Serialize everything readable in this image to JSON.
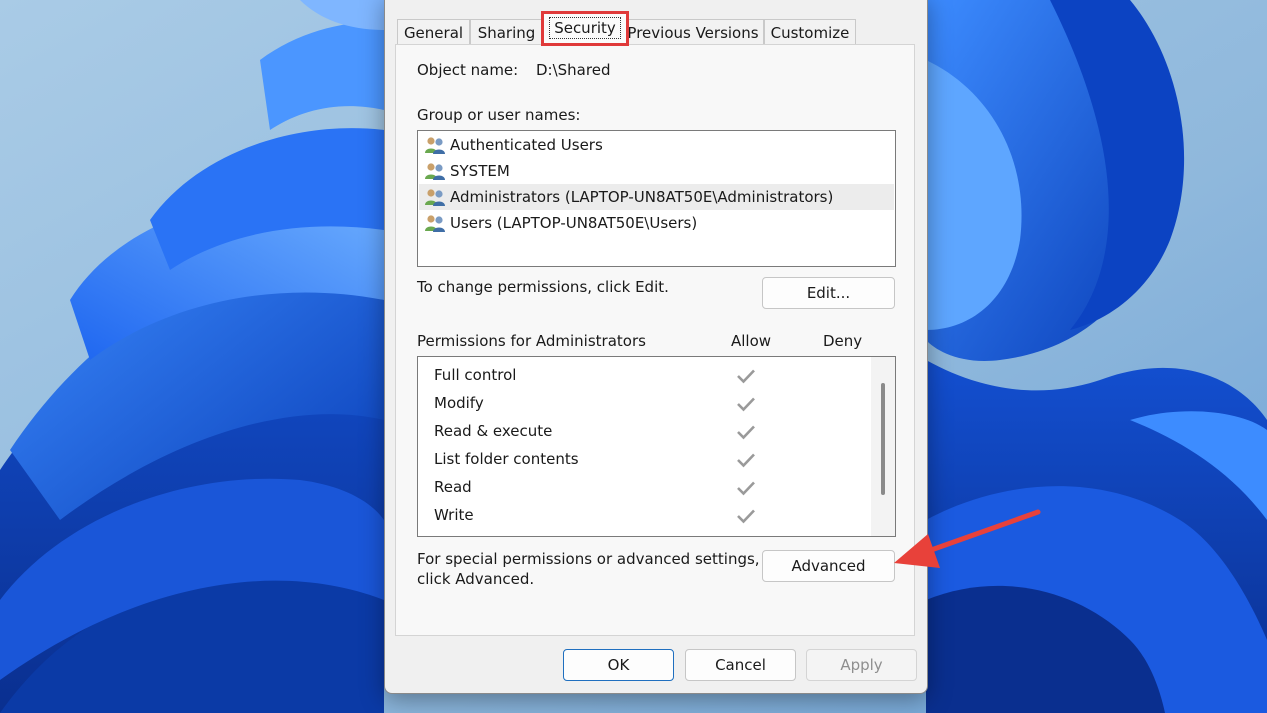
{
  "tabs": [
    {
      "label": "General"
    },
    {
      "label": "Sharing"
    },
    {
      "label": "Security"
    },
    {
      "label": "Previous Versions"
    },
    {
      "label": "Customize"
    }
  ],
  "object": {
    "label": "Object name:",
    "value": "D:\\Shared"
  },
  "groups": {
    "label": "Group or user names:",
    "items": [
      {
        "label": "Authenticated Users"
      },
      {
        "label": "SYSTEM"
      },
      {
        "label": "Administrators (LAPTOP-UN8AT50E\\Administrators)"
      },
      {
        "label": "Users (LAPTOP-UN8AT50E\\Users)"
      }
    ]
  },
  "edit": {
    "text": "To change permissions, click Edit.",
    "button": "Edit..."
  },
  "permissions": {
    "label": "Permissions for Administrators",
    "allow_header": "Allow",
    "deny_header": "Deny",
    "items": [
      {
        "name": "Full control",
        "allow": true,
        "deny": false
      },
      {
        "name": "Modify",
        "allow": true,
        "deny": false
      },
      {
        "name": "Read & execute",
        "allow": true,
        "deny": false
      },
      {
        "name": "List folder contents",
        "allow": true,
        "deny": false
      },
      {
        "name": "Read",
        "allow": true,
        "deny": false
      },
      {
        "name": "Write",
        "allow": true,
        "deny": false
      }
    ]
  },
  "advanced": {
    "text_line1": "For special permissions or advanced settings,",
    "text_line2": "click Advanced.",
    "button": "Advanced"
  },
  "footer": {
    "ok": "OK",
    "cancel": "Cancel",
    "apply": "Apply"
  },
  "colors": {
    "highlight_box": "#e03a3a",
    "annotation_arrow": "#e8413a",
    "check_gray": "#9a9a9a",
    "wallpaper_blue": "#1d5fe0"
  }
}
